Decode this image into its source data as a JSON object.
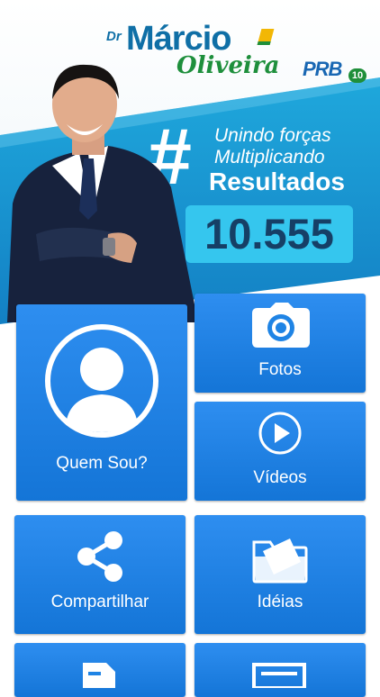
{
  "brand": {
    "prefix": "Dr",
    "first_name": "Márcio",
    "last_name": "Oliveira",
    "party": "PRB",
    "party_number": "10"
  },
  "banner": {
    "hashtag": "#",
    "line1": "Unindo forças",
    "line2": "Multiplicando",
    "line3": "Resultados",
    "candidate_number": "10.555"
  },
  "menu": {
    "about_label": "Quem Sou?",
    "photos_label": "Fotos",
    "videos_label": "Vídeos",
    "share_label": "Compartilhar",
    "ideas_label": "Idéias"
  },
  "colors": {
    "tile": "#1f84e5",
    "hero_blue": "#1aa3d6",
    "number_box": "#35c6ee",
    "number_text": "#163f66",
    "brand_blue": "#0f6fa6",
    "brand_green": "#1e8f3c"
  },
  "icons": [
    "avatar-icon",
    "camera-icon",
    "play-icon",
    "share-icon",
    "folder-icon",
    "document-icon",
    "newspaper-icon"
  ]
}
